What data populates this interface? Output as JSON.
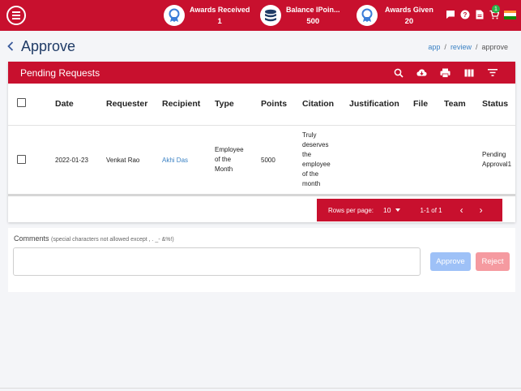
{
  "topbar": {
    "stats": [
      {
        "label": "Awards Received",
        "value": "1",
        "icon": "award-ribbon-icon"
      },
      {
        "label": "Balance IPoin...",
        "value": "500",
        "icon": "coin-stack-icon"
      },
      {
        "label": "Awards Given",
        "value": "20",
        "icon": "award-ribbon-icon"
      }
    ],
    "cart_count": "1",
    "icons": [
      "chat-icon",
      "help-icon",
      "document-icon",
      "cart-icon",
      "india-flag-icon"
    ]
  },
  "page": {
    "title": "Approve",
    "breadcrumb": {
      "items": [
        "app",
        "review",
        "approve"
      ],
      "separator": "/"
    }
  },
  "table_card": {
    "title": "Pending Requests",
    "toolbar_icons": [
      "search-icon",
      "cloud-download-icon",
      "print-icon",
      "view-columns-icon",
      "filter-icon"
    ],
    "columns": [
      "Date",
      "Requester",
      "Recipient",
      "Type",
      "Points",
      "Citation",
      "Justification",
      "File",
      "Team",
      "Status"
    ],
    "rows": [
      {
        "date": "2022-01-23",
        "requester": "Venkat Rao",
        "recipient": "Akhi Das",
        "type_lines": [
          "Employee",
          "of the",
          "Month"
        ],
        "points": "5000",
        "citation_lines": [
          "Truly",
          "deserves",
          "the",
          "employee",
          "of the",
          "month"
        ],
        "justification": "",
        "file": "",
        "team": "",
        "status_lines": [
          "Pending",
          "Approval1"
        ]
      }
    ],
    "pagination": {
      "rows_per_page_label": "Rows per page:",
      "rows_per_page": "10",
      "range": "1-1 of 1",
      "prev": "‹",
      "next": "›"
    }
  },
  "comments": {
    "label": "Comments",
    "hint": "(special characters not allowed except , . _- &%!)",
    "value": "",
    "approve_label": "Approve",
    "reject_label": "Reject"
  },
  "colors": {
    "brand": "#c8102e",
    "approve_disabled": "#9ec1f7",
    "reject_disabled": "#f59aa0",
    "link": "#3b82c4"
  }
}
